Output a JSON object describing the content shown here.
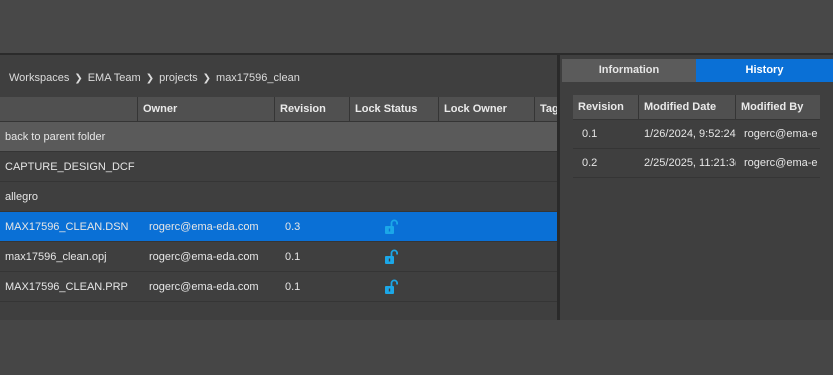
{
  "breadcrumb": [
    "Workspaces",
    "EMA Team",
    "projects",
    "max17596_clean"
  ],
  "file_table": {
    "headers": {
      "name": "",
      "owner": "Owner",
      "revision": "Revision",
      "lock_status": "Lock Status",
      "lock_owner": "Lock Owner",
      "tags": "Tags"
    },
    "parent_row": "back to parent folder",
    "folders": [
      "CAPTURE_DESIGN_DCF",
      "allegro"
    ],
    "files": [
      {
        "name": "MAX17596_CLEAN.DSN",
        "owner": "rogerc@ema-eda.com",
        "revision": "0.3",
        "lock": "unlocked-icon",
        "selected": true
      },
      {
        "name": "max17596_clean.opj",
        "owner": "rogerc@ema-eda.com",
        "revision": "0.1",
        "lock": "unlocked-icon",
        "selected": false
      },
      {
        "name": "MAX17596_CLEAN.PRP",
        "owner": "rogerc@ema-eda.com",
        "revision": "0.1",
        "lock": "unlocked-icon",
        "selected": false
      }
    ]
  },
  "right_panel": {
    "tabs": {
      "information": "Information",
      "history": "History"
    },
    "active_tab": "History",
    "history": {
      "headers": {
        "revision": "Revision",
        "modified_date": "Modified Date",
        "modified_by": "Modified By"
      },
      "rows": [
        {
          "revision": "0.1",
          "modified_date": "1/26/2024, 9:52:24",
          "modified_by": "rogerc@ema-e"
        },
        {
          "revision": "0.2",
          "modified_date": "2/25/2025, 11:21:3(",
          "modified_by": "rogerc@ema-e"
        }
      ]
    }
  },
  "colors": {
    "accent": "#0a70d6",
    "lock_icon": "#1ba7e8",
    "background": "#3f3f3f"
  }
}
